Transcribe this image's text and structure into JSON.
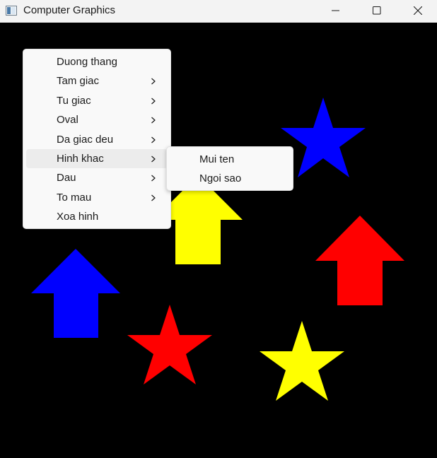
{
  "window": {
    "title": "Computer Graphics",
    "icon": "app-window-icon",
    "controls": [
      "minimize-icon",
      "maximize-icon",
      "close-icon"
    ]
  },
  "menu": {
    "items": [
      {
        "label": "Duong thang",
        "has_submenu": false
      },
      {
        "label": "Tam giac",
        "has_submenu": true
      },
      {
        "label": "Tu giac",
        "has_submenu": true
      },
      {
        "label": "Oval",
        "has_submenu": true
      },
      {
        "label": "Da giac deu",
        "has_submenu": true
      },
      {
        "label": "Hinh khac",
        "has_submenu": true,
        "highlighted": true
      },
      {
        "label": "Dau",
        "has_submenu": true
      },
      {
        "label": "To mau",
        "has_submenu": true
      },
      {
        "label": "Xoa hinh",
        "has_submenu": false
      }
    ]
  },
  "submenu": {
    "parent": "Hinh khac",
    "items": [
      {
        "label": "Mui ten"
      },
      {
        "label": "Ngoi sao"
      }
    ]
  },
  "canvas": {
    "background": "#000000",
    "shapes": [
      {
        "type": "arrow-up",
        "color": "#ffff00"
      },
      {
        "type": "arrow-up",
        "color": "#0000ff"
      },
      {
        "type": "arrow-up",
        "color": "#ff0000"
      },
      {
        "type": "star",
        "color": "#0000ff"
      },
      {
        "type": "star",
        "color": "#ff0000"
      },
      {
        "type": "star",
        "color": "#ffff00"
      }
    ]
  }
}
